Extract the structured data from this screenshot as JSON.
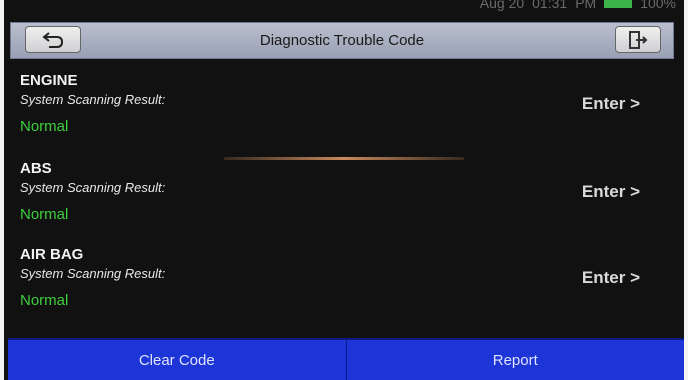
{
  "status_bar": {
    "date": "Aug 20",
    "time": "01:31",
    "meridiem": "PM",
    "battery": "100%"
  },
  "header": {
    "title": "Diagnostic Trouble Code"
  },
  "systems": [
    {
      "name": "ENGINE",
      "subtitle": "System Scanning Result:",
      "status": "Normal",
      "action": "Enter >"
    },
    {
      "name": "ABS",
      "subtitle": "System Scanning Result:",
      "status": "Normal",
      "action": "Enter >"
    },
    {
      "name": "AIR BAG",
      "subtitle": "System Scanning Result:",
      "status": "Normal",
      "action": "Enter >"
    }
  ],
  "footer": {
    "clear_label": "Clear Code",
    "report_label": "Report"
  },
  "colors": {
    "header_bg": "#a9b0c1",
    "status_green": "#3fcf3f",
    "footer_blue": "#1d34d6"
  }
}
